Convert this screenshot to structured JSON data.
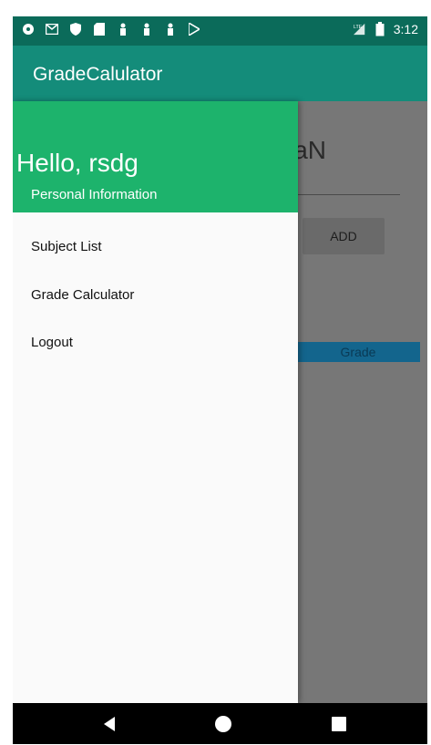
{
  "status_bar": {
    "time": "3:12",
    "network": "LTE",
    "icons": [
      "message-icon",
      "gmail-icon",
      "shield-icon",
      "sd-card-icon",
      "person-icon",
      "person-icon",
      "person-icon",
      "play-store-icon",
      "signal-icon",
      "battery-icon"
    ]
  },
  "app_bar": {
    "title": "GradeCalulator"
  },
  "background_content": {
    "gpa_value": "NaN",
    "add_button": "ADD",
    "grade_header": "Grade"
  },
  "drawer": {
    "greeting": "Hello,  rsdg",
    "subtitle": "Personal Information",
    "menu": [
      {
        "label": "Subject List"
      },
      {
        "label": "Grade Calculator"
      },
      {
        "label": "Logout"
      }
    ]
  },
  "colors": {
    "status_bar": "#0b6b5a",
    "app_bar": "#148c7a",
    "drawer_header": "#1db36c",
    "scrim": "#777777",
    "grade_header": "#13658d"
  }
}
